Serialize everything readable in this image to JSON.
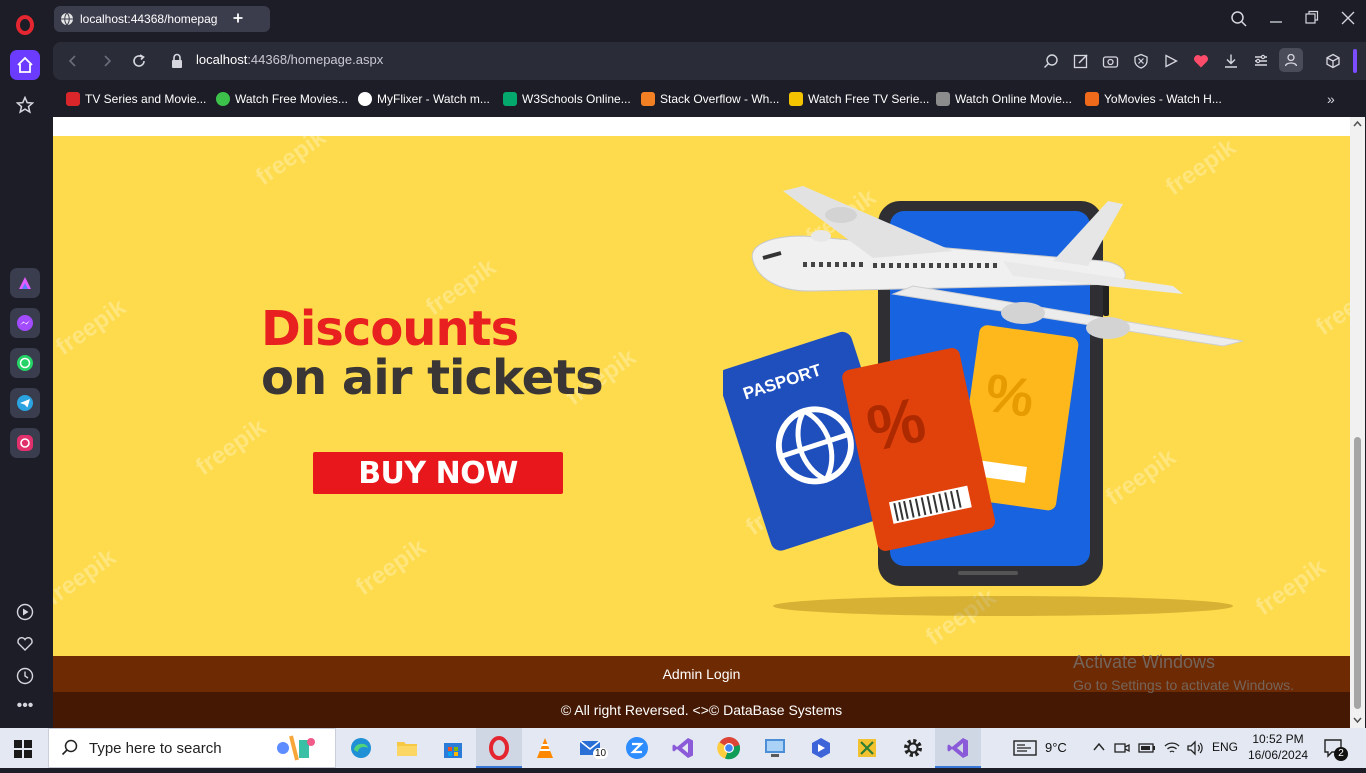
{
  "browser": {
    "tab_title": "localhost:44368/homepag",
    "url_prefix": "localhost",
    "url_rest": ":44368/homepage.aspx"
  },
  "bookmarks": [
    {
      "label": "TV Series and Movie...",
      "color": "#d8262a"
    },
    {
      "label": "Watch Free Movies...",
      "color": "#3cc24a"
    },
    {
      "label": "MyFlixer - Watch m...",
      "color": "#ffffff"
    },
    {
      "label": "W3Schools Online...",
      "color": "#04aa6d"
    },
    {
      "label": "Stack Overflow - Wh...",
      "color": "#f48024"
    },
    {
      "label": "Watch Free TV Serie...",
      "color": "#f5c400"
    },
    {
      "label": "Watch Online Movie...",
      "color": "#8c8c8c"
    },
    {
      "label": "YoMovies - Watch H...",
      "color": "#f06a1b"
    }
  ],
  "banner": {
    "headline_red": "Discounts",
    "headline_dark": "on air tickets",
    "cta": "BUY NOW",
    "passport_text": "PASPORT",
    "watermark": "freepik"
  },
  "footer": {
    "admin_link": "Admin Login",
    "copyright": "© All right Reversed. <>© DataBase Systems"
  },
  "activation": {
    "line1": "Activate Windows",
    "line2": "Go to Settings to activate Windows."
  },
  "taskbar": {
    "search_placeholder": "Type here to search",
    "weather": "9°C",
    "language": "ENG",
    "time": "10:52 PM",
    "date": "16/06/2024",
    "mail_badge": "10",
    "notification_badge": "2"
  }
}
